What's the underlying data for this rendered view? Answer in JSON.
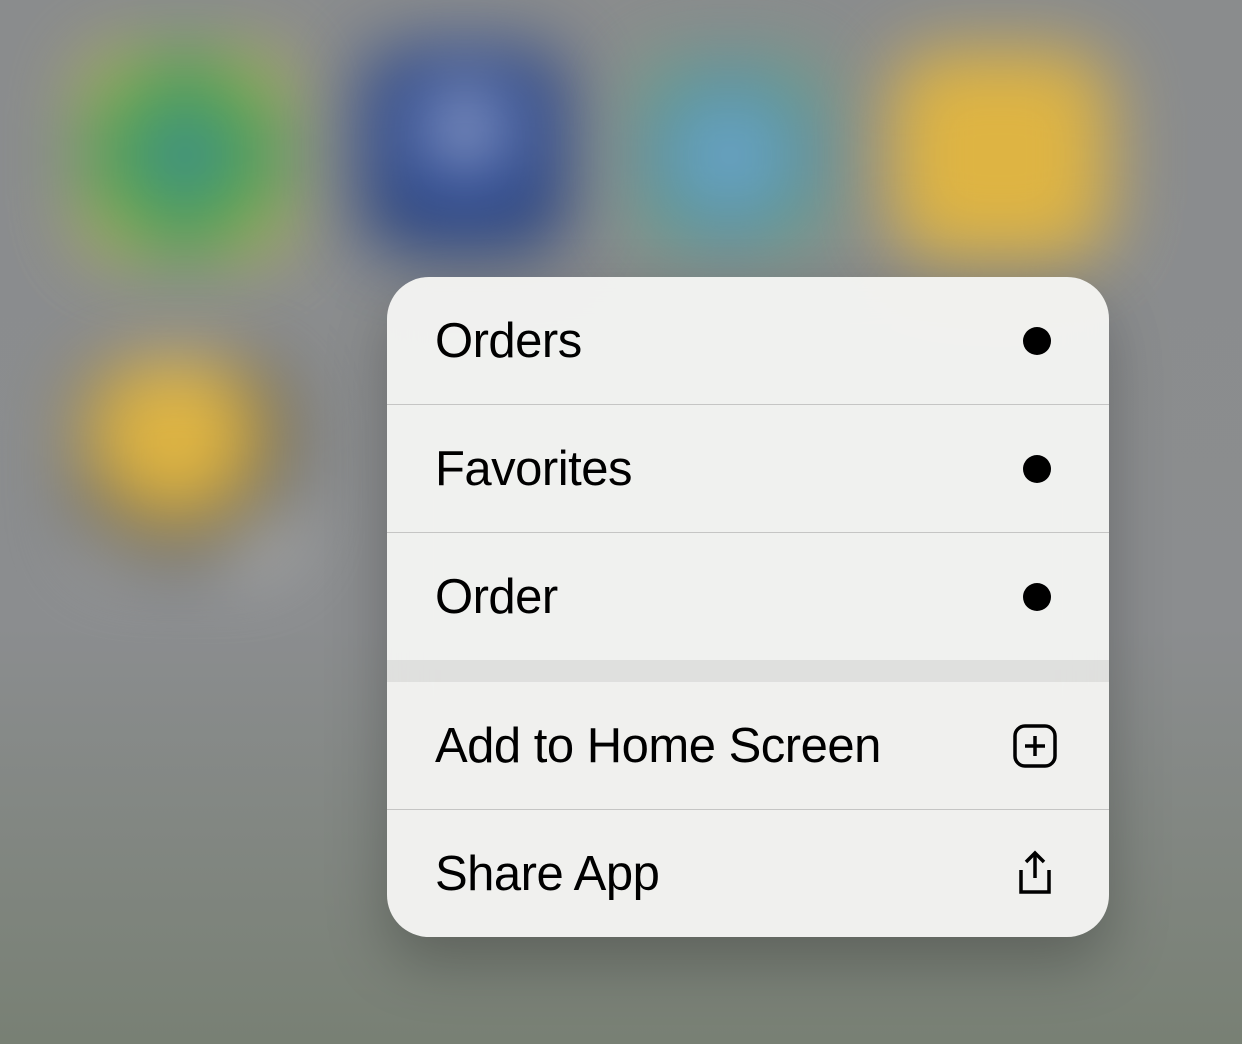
{
  "menu": {
    "app_actions": [
      {
        "label": "Orders",
        "icon": "dot"
      },
      {
        "label": "Favorites",
        "icon": "dot"
      },
      {
        "label": "Order",
        "icon": "dot"
      }
    ],
    "system_actions": [
      {
        "label": "Add to Home Screen",
        "icon": "plus-square"
      },
      {
        "label": "Share App",
        "icon": "share"
      }
    ]
  }
}
